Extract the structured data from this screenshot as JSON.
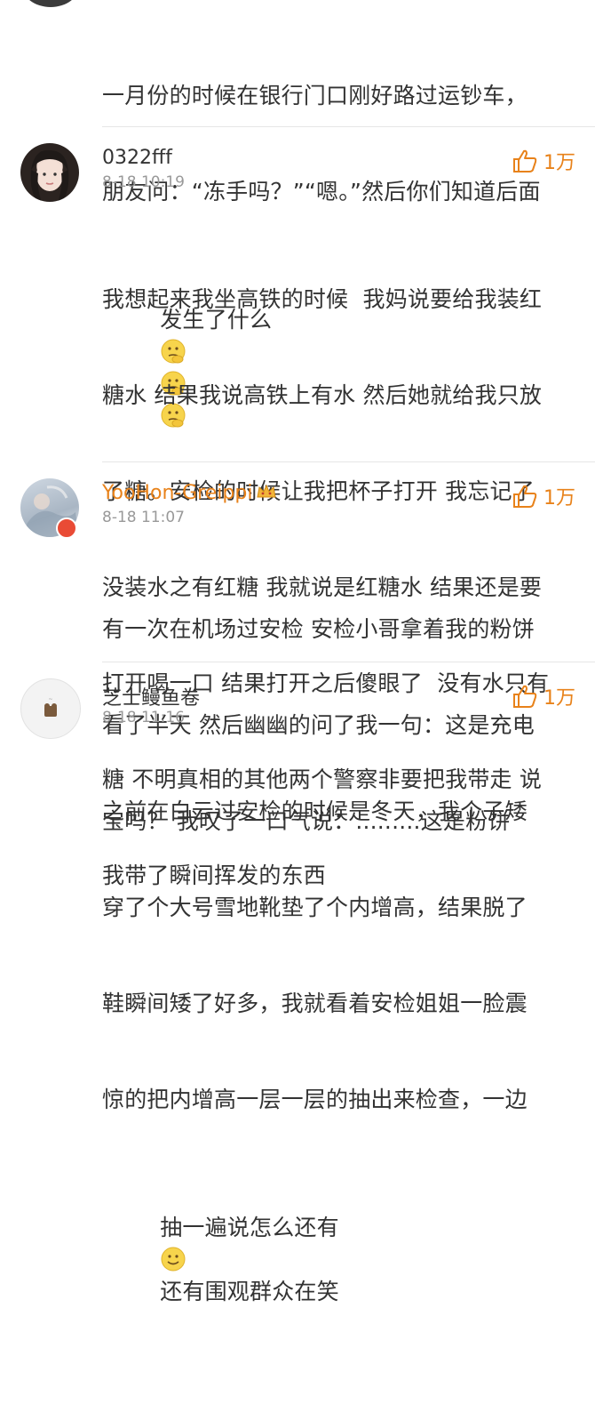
{
  "comments": [
    {
      "text_line1": "一月份的时候在银行门口刚好路过运钞车，",
      "text_line2": "朋友问：“冻手吗？”“嗯。”然后你们知道后面",
      "text_line3": "发生了什么"
    },
    {
      "username": "0322fff",
      "timestamp": "8-18 10:19",
      "likes": "1万",
      "lines": [
        "我想起来我坐高铁的时候  我妈说要给我装红",
        "糖水 结果我说高铁上有水 然后她就给我只放",
        "了糖。安检的时候让我把杯子打开 我忘记了",
        "没装水之有红糖 我就说是红糖水 结果还是要",
        "打开喝一口 结果打开之后傻眼了  没有水只有",
        "糖 不明真相的其他两个警察非要把我带走 说",
        "我带了瞬间挥发的东西"
      ]
    },
    {
      "username": "YooHon-Greippi",
      "timestamp": "8-18 11:07",
      "likes": "1万",
      "lines": [
        "有一次在机场过安检 安检小哥拿着我的粉饼",
        "看了半天 然后幽幽的问了我一句：这是充电",
        "宝吗？ 我叹了一口气说：.........这是粉饼"
      ]
    },
    {
      "username": "芝士鳗鱼卷",
      "timestamp": "8-18 11:16",
      "likes": "1万",
      "lines": [
        "之前在白云过安检的时候是冬天，我个子矮",
        "穿了个大号雪地靴垫了个内增高，结果脱了",
        "鞋瞬间矮了好多，我就看着安检姐姐一脸震",
        "惊的把内增高一层一层的抽出来检查，一边",
        "抽一遍说怎么还有",
        "还有围观群众在笑"
      ]
    }
  ],
  "colors": {
    "like_accent": "#e8821a",
    "vip_name": "#e8821a"
  }
}
